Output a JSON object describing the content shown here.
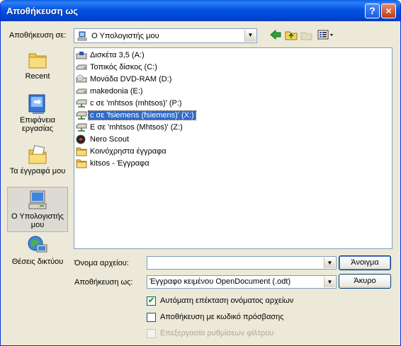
{
  "window": {
    "title": "Αποθήκευση ως",
    "help_label": "?",
    "close_label": "×"
  },
  "save_in": {
    "label": "Αποθήκευση σε:",
    "value": "Ο Υπολογιστής μου"
  },
  "toolbar": {
    "back_icon": "back-arrow-icon",
    "up_icon": "folder-up-icon",
    "new_folder_icon": "new-folder-icon",
    "views_icon": "views-menu-icon"
  },
  "places": [
    {
      "label": "Recent",
      "icon": "recent-icon"
    },
    {
      "label": "Επιφάνεια εργασίας",
      "icon": "desktop-icon"
    },
    {
      "label": "Τα έγγραφά μου",
      "icon": "my-documents-icon"
    },
    {
      "label": "Ο Υπολογιστής μου",
      "icon": "my-computer-icon",
      "selected": true
    },
    {
      "label": "Θέσεις δικτύου",
      "icon": "network-places-icon"
    }
  ],
  "files": [
    {
      "label": "Δισκέτα 3,5 (A:)",
      "icon": "floppy-drive-icon"
    },
    {
      "label": "Τοπικός δίσκος (C:)",
      "icon": "hard-drive-icon"
    },
    {
      "label": "Μονάδα DVD-RAM (D:)",
      "icon": "dvd-drive-icon"
    },
    {
      "label": "makedonia (E:)",
      "icon": "hard-drive-icon"
    },
    {
      "label": "c σε 'mhtsos (mhtsos)' (P:)",
      "icon": "network-drive-icon"
    },
    {
      "label": "c σε 'fsiemens (fsiemens)' (X:)",
      "icon": "network-drive-icon",
      "selected": true
    },
    {
      "label": "E σε 'mhtsos (Mhtsos)' (Z:)",
      "icon": "network-drive-icon"
    },
    {
      "label": "Nero Scout",
      "icon": "nero-scout-icon"
    },
    {
      "label": "Κοινόχρηστα έγγραφα",
      "icon": "shared-folder-icon"
    },
    {
      "label": "kitsos - Έγγραφα",
      "icon": "folder-icon"
    }
  ],
  "filename": {
    "label": "Όνομα αρχείου:",
    "value": ""
  },
  "filetype": {
    "label": "Αποθήκευση ως:",
    "value": "Έγγραφο κειμένου OpenDocument (.odt)"
  },
  "buttons": {
    "open": "Άνοιγμα",
    "cancel": "Άκυρο"
  },
  "options": [
    {
      "label": "Αυτόματη επέκταση ονόματος αρχείων",
      "checked": true,
      "disabled": false
    },
    {
      "label": "Αποθήκευση με κωδικό πρόσβασης",
      "checked": false,
      "disabled": false
    },
    {
      "label": "Επεξεργασία ρυθμίσεων φίλτρου",
      "checked": false,
      "disabled": true
    }
  ]
}
